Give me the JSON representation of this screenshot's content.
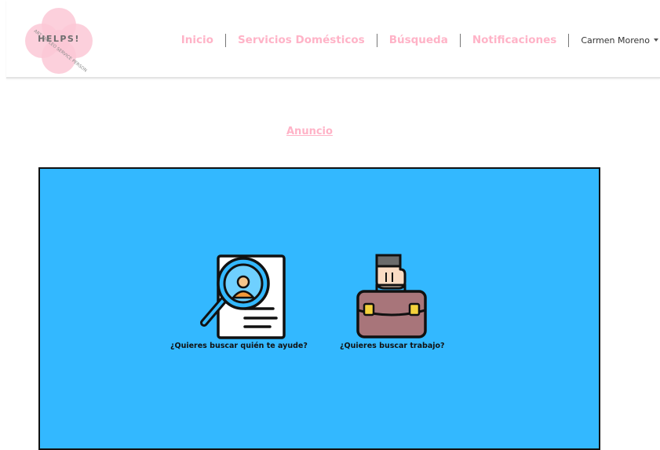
{
  "logo": {
    "text": "HELPS!",
    "subtext": "ART EMPLEO SERVICE PERSON",
    "icon": "flower-logo-icon"
  },
  "nav": {
    "items": [
      {
        "label": "Inicio"
      },
      {
        "label": "Servicios Domésticos"
      },
      {
        "label": "Búsqueda"
      },
      {
        "label": "Notificaciones"
      }
    ],
    "user": {
      "name": "Carmen Moreno",
      "icon": "caret-down-icon"
    }
  },
  "anuncio": {
    "label": "Anuncio"
  },
  "options": [
    {
      "label": "¿Quieres buscar quién te ayude?",
      "icon": "magnifier-profile-icon"
    },
    {
      "label": "¿Quieres buscar trabajo?",
      "icon": "briefcase-hand-icon"
    }
  ],
  "colors": {
    "accent": "#ffb3c7",
    "panel": "#33b8ff",
    "logo": "#fbc8d6"
  }
}
